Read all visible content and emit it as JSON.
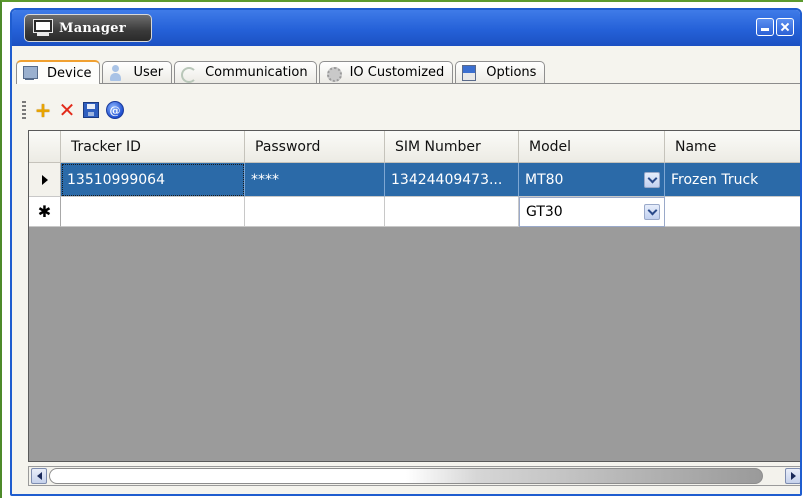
{
  "window": {
    "title": "Manager",
    "icon": "monitor-icon",
    "buttons": [
      "minimize-icon",
      "close-icon"
    ]
  },
  "tabs": [
    {
      "label": "Device",
      "icon": "device-icon",
      "active": true
    },
    {
      "label": "User",
      "icon": "user-icon",
      "active": false
    },
    {
      "label": "Communication",
      "icon": "communication-icon",
      "active": false
    },
    {
      "label": "IO Customized",
      "icon": "gear-icon",
      "active": false
    },
    {
      "label": "Options",
      "icon": "options-icon",
      "active": false
    }
  ],
  "toolbar": {
    "add": "+",
    "delete": "✕",
    "info": "@"
  },
  "grid": {
    "columns": [
      "Tracker ID",
      "Password",
      "SIM Number",
      "Model",
      "Name"
    ],
    "rows": [
      {
        "tracker_id": "13510999064",
        "password": "****",
        "sim_number": "13424409473...",
        "model": "MT80",
        "name": "Frozen Truck",
        "selected": true
      },
      {
        "tracker_id": "",
        "password": "",
        "sim_number": "",
        "model": "GT30",
        "name": "",
        "new_row": true
      }
    ],
    "row_markers": {
      "current": "▶",
      "new": "✱"
    }
  },
  "colors": {
    "titlebar": "#2561d8",
    "selection": "#2b6aa8",
    "active_tab_accent": "#f0a030"
  }
}
